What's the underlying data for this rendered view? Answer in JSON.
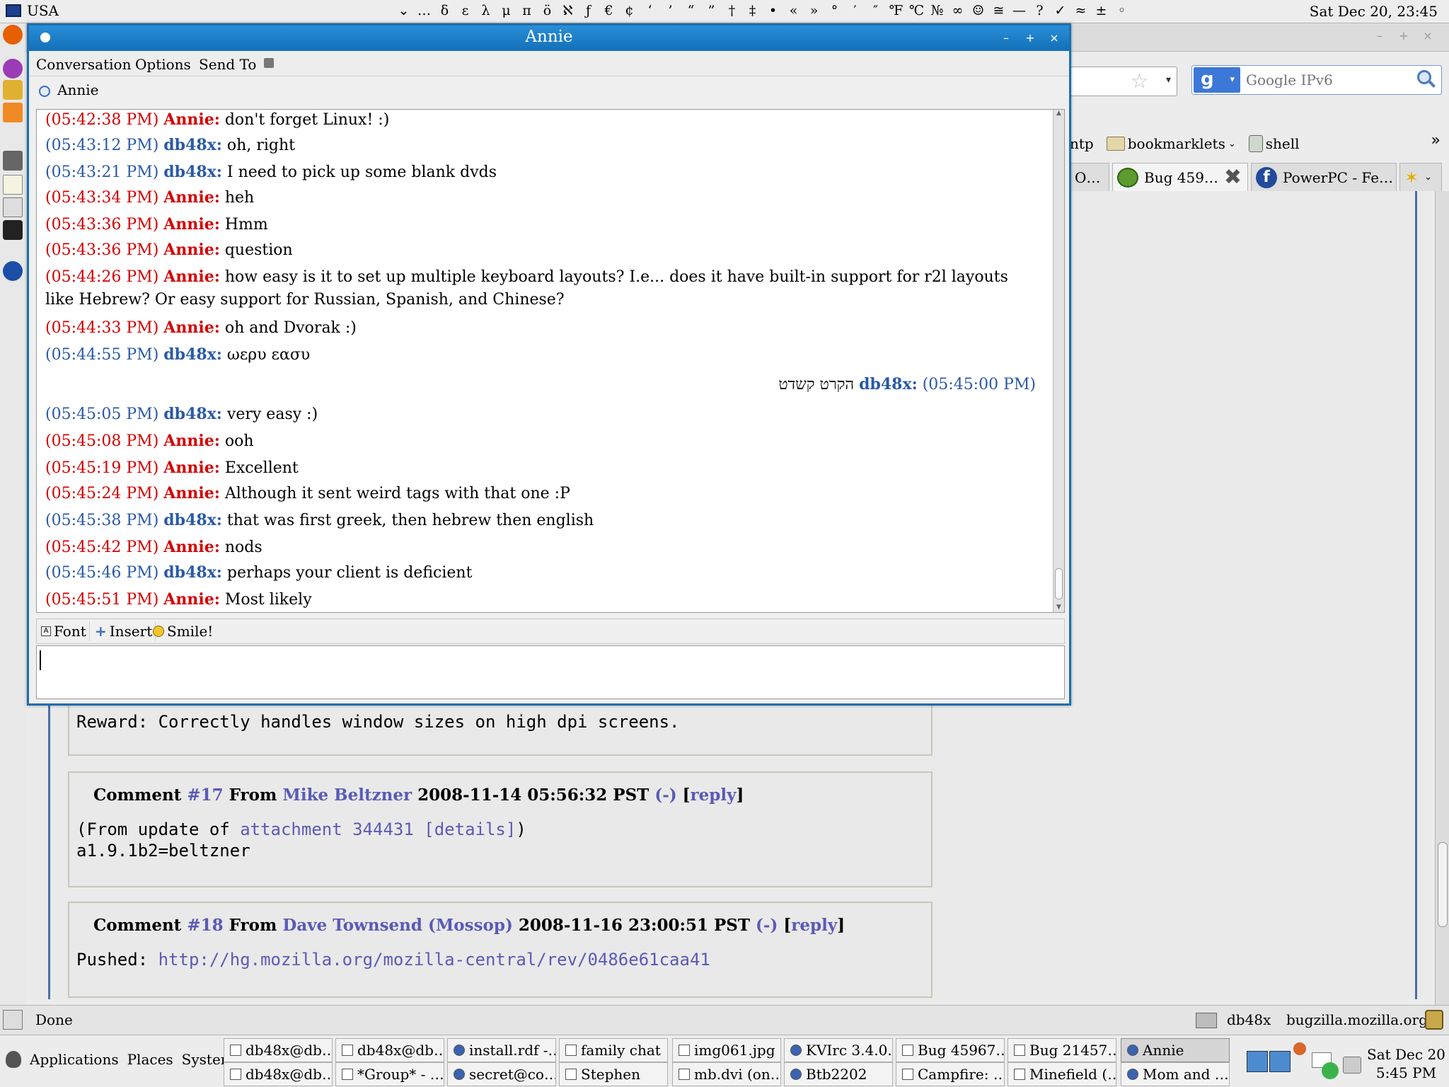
{
  "top_panel": {
    "keyboard_layout": "USA",
    "chars": [
      "⌄",
      "…",
      "δ",
      "ε",
      "λ",
      "μ",
      "π",
      "ö",
      "ℵ",
      "ƒ",
      "€",
      "¢",
      "‘",
      "’",
      "“",
      "”",
      "†",
      "‡",
      "•",
      "«",
      "»",
      "°",
      "′",
      "″",
      "℉",
      "℃",
      "№",
      "∞",
      "☺",
      "≅",
      "—",
      "?",
      "✓",
      "≈",
      "±",
      "◦"
    ],
    "clock": "Sat Dec 20, 23:45"
  },
  "browser": {
    "search_placeholder": "Google IPv6",
    "bookmarks": [
      {
        "label": "ntp"
      },
      {
        "label": "bookmarklets",
        "has_dropdown": true
      },
      {
        "label": "shell"
      }
    ],
    "bookmarks_overflow": "»",
    "tabs": [
      {
        "label": "O…"
      },
      {
        "label": "Bug 459…",
        "active": true
      },
      {
        "label": "PowerPC - Fe…"
      }
    ],
    "comments": [
      {
        "body_lines": [
          "Reward: Correctly handles window sizes on high dpi screens."
        ]
      },
      {
        "label": "Comment",
        "number": "#17",
        "from": "From",
        "author": "Mike Beltzner",
        "date": "2008-11-14 05:56:32 PST",
        "dash": "(-)",
        "reply_open": "[",
        "reply": "reply",
        "reply_close": "]",
        "body_prefix": "(From update of ",
        "body_link": "attachment 344431",
        "body_details": "[details]",
        "body_suffix": ")",
        "body_line2": "a1.9.1b2=beltzner"
      },
      {
        "label": "Comment",
        "number": "#18",
        "from": "From",
        "author": "Dave Townsend (Mossop)",
        "date": "2008-11-16 23:00:51 PST",
        "dash": "(-)",
        "reply_open": "[",
        "reply": "reply",
        "reply_close": "]",
        "body_prefix": "Pushed: ",
        "body_link": "http://hg.mozilla.org/mozilla-central/rev/0486e61caa41"
      }
    ],
    "status": {
      "text": "Done",
      "user": "db48x",
      "host": "bugzilla.mozilla.org"
    }
  },
  "chat": {
    "title": "Annie",
    "menus": [
      "Conversation",
      "Options",
      "Send To"
    ],
    "tab_name": "Annie",
    "messages": [
      {
        "time": "(05:42:38 PM)",
        "sender": "Annie:",
        "who": "annie",
        "text": "don't forget Linux! :)"
      },
      {
        "time": "(05:43:12 PM)",
        "sender": "db48x:",
        "who": "me",
        "text": "oh, right"
      },
      {
        "time": "(05:43:21 PM)",
        "sender": "db48x:",
        "who": "me",
        "text": "I need to pick up some blank dvds"
      },
      {
        "time": "(05:43:34 PM)",
        "sender": "Annie:",
        "who": "annie",
        "text": "heh"
      },
      {
        "time": "(05:43:36 PM)",
        "sender": "Annie:",
        "who": "annie",
        "text": "Hmm"
      },
      {
        "time": "(05:43:36 PM)",
        "sender": "Annie:",
        "who": "annie",
        "text": "question"
      },
      {
        "time": "(05:44:26 PM)",
        "sender": "Annie:",
        "who": "annie",
        "text": "how easy is it to set up multiple keyboard layouts? I.e... does it have built-in support for r2l layouts like Hebrew? Or easy support for Russian, Spanish, and Chinese?"
      },
      {
        "time": "(05:44:33 PM)",
        "sender": "Annie:",
        "who": "annie",
        "text": "oh and Dvorak :)"
      },
      {
        "time": "(05:44:55 PM)",
        "sender": "db48x:",
        "who": "me",
        "text": "ωερυ εασυ"
      },
      {
        "time": "(05:45:00 PM)",
        "sender": "db48x:",
        "who": "me",
        "text": "הקרט קשדט",
        "rtl": true
      },
      {
        "time": "(05:45:05 PM)",
        "sender": "db48x:",
        "who": "me",
        "text": "very easy :)"
      },
      {
        "time": "(05:45:08 PM)",
        "sender": "Annie:",
        "who": "annie",
        "text": "ooh"
      },
      {
        "time": "(05:45:19 PM)",
        "sender": "Annie:",
        "who": "annie",
        "text": "Excellent"
      },
      {
        "time": "(05:45:24 PM)",
        "sender": "Annie:",
        "who": "annie",
        "text": "Although it sent weird tags with that one :P"
      },
      {
        "time": "(05:45:38 PM)",
        "sender": "db48x:",
        "who": "me",
        "text": "that was first greek, then hebrew then english"
      },
      {
        "time": "(05:45:42 PM)",
        "sender": "Annie:",
        "who": "annie",
        "text": "nods"
      },
      {
        "time": "(05:45:46 PM)",
        "sender": "db48x:",
        "who": "me",
        "text": "perhaps your client is deficient"
      },
      {
        "time": "(05:45:51 PM)",
        "sender": "Annie:",
        "who": "annie",
        "text": "Most likely"
      }
    ],
    "toolbar": {
      "font": "Font",
      "insert": "Insert",
      "smile": "Smile!"
    },
    "input_value": ""
  },
  "taskbar": {
    "menus": [
      "Applications",
      "Places",
      "System"
    ],
    "row1": [
      "db48x@db…",
      "db48x@db…",
      "install.rdf -…",
      "family chat",
      "img061.jpg",
      "KVIrc 3.4.0…",
      "Bug 45967…",
      "Bug 21457…",
      "Annie"
    ],
    "row2": [
      "db48x@db…",
      "*Group* - …",
      "secret@co…",
      "Stephen",
      "mb.dvi (on…",
      "Btb2202",
      "Campfire: …",
      "Minefield (…",
      "Mom and …"
    ],
    "active": "Annie",
    "clock_line1": "Sat Dec 20",
    "clock_line2": "5:45 PM"
  },
  "colors": {
    "annie": "#d40000",
    "me": "#2a5aa5",
    "titlebar": "#1a7ac4",
    "link": "#5a5ab8"
  }
}
